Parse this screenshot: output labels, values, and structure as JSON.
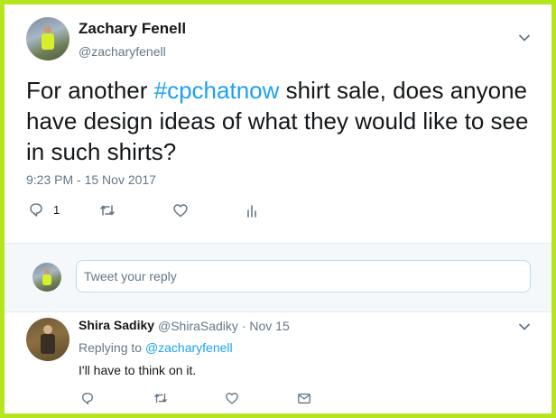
{
  "tweet": {
    "author_name": "Zachary Fenell",
    "author_handle": "@zacharyfenell",
    "text_before": "For another ",
    "hashtag": "#cpchatnow",
    "text_after": " shirt sale, does anyone have design ideas of what they would like to see in such shirts?",
    "timestamp": "9:23 PM - 15 Nov 2017",
    "reply_count": "1",
    "icons": [
      "reply-icon",
      "retweet-icon",
      "like-icon",
      "analytics-icon",
      "chevron-down-icon"
    ]
  },
  "reply_box": {
    "placeholder": "Tweet your reply"
  },
  "reply": {
    "author_name": "Shira Sadiky",
    "author_handle": "@ShiraSadiky",
    "separator": "·",
    "date": "Nov 15",
    "replying_label": "Replying to",
    "replying_to": "@zacharyfenell",
    "text": "I'll have to think on it.",
    "icons": [
      "reply-icon",
      "retweet-icon",
      "like-icon",
      "direct-message-icon",
      "chevron-down-icon"
    ]
  },
  "colors": {
    "border_highlight": "#b5e61d",
    "link": "#1da1f2",
    "muted": "#657786",
    "text": "#14171a"
  }
}
